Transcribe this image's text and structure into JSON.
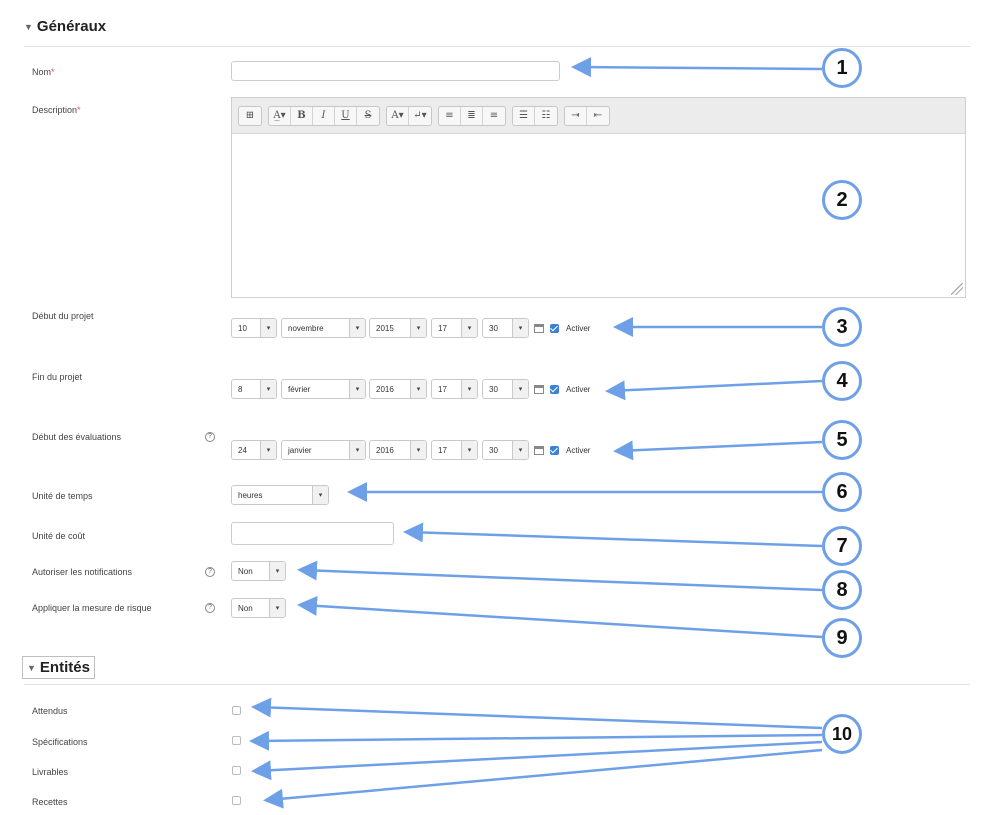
{
  "sections": {
    "generaux": "Généraux",
    "entites": "Entités"
  },
  "fields": {
    "nom": "Nom",
    "description": "Description",
    "debut_projet": "Début du projet",
    "fin_projet": "Fin du projet",
    "debut_evaluations": "Début des évaluations",
    "unite_temps": "Unité de temps",
    "unite_cout": "Unité de coût",
    "autoriser_notifications": "Autoriser les notifications",
    "appliquer_risque": "Appliquer la mesure de risque"
  },
  "required_mark": "*",
  "help_glyph": "?",
  "editor_toolbar": [
    [
      "⊞"
    ],
    [
      "A̲▾",
      "B",
      "I",
      "U",
      "S"
    ],
    [
      "A▾",
      "↵▾"
    ],
    [
      "≡",
      "≣",
      "≡"
    ],
    [
      "☰",
      "☷"
    ],
    [
      "⇥",
      "⇤"
    ]
  ],
  "dates": {
    "debut_projet": {
      "day": "10",
      "month": "novembre",
      "year": "2015",
      "hour": "17",
      "minute": "30",
      "enable_label": "Activer"
    },
    "fin_projet": {
      "day": "8",
      "month": "février",
      "year": "2016",
      "hour": "17",
      "minute": "30",
      "enable_label": "Activer"
    },
    "debut_evaluations": {
      "day": "24",
      "month": "janvier",
      "year": "2016",
      "hour": "17",
      "minute": "30",
      "enable_label": "Activer"
    }
  },
  "select_arrow": "▾",
  "unite_temps_value": "heures",
  "notifications_value": "Non",
  "risque_value": "Non",
  "entites": [
    "Attendus",
    "Spécifications",
    "Livrables",
    "Recettes"
  ],
  "badges": [
    "1",
    "2",
    "3",
    "4",
    "5",
    "6",
    "7",
    "8",
    "9",
    "10"
  ],
  "colors": {
    "annotation": "#6ea0e8",
    "checkbox_on": "#3b82d6",
    "required": "#d9534f"
  }
}
